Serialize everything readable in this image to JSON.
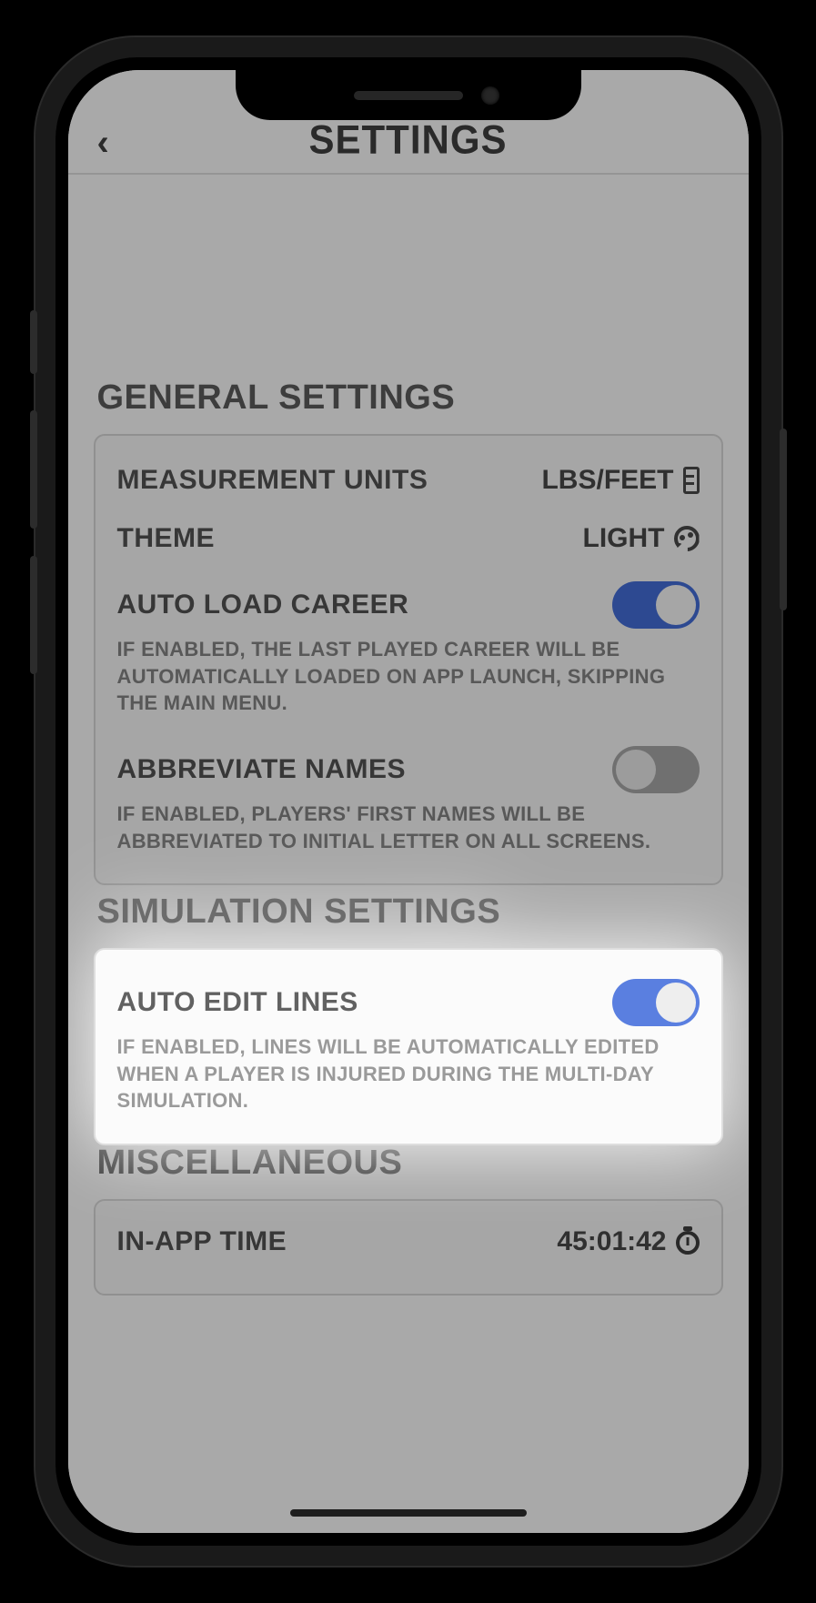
{
  "header": {
    "title": "SETTINGS"
  },
  "sections": {
    "general": {
      "title": "GENERAL SETTINGS",
      "measurement_units": {
        "label": "MEASUREMENT UNITS",
        "value": "LBS/FEET"
      },
      "theme": {
        "label": "THEME",
        "value": "LIGHT"
      },
      "auto_load_career": {
        "label": "AUTO LOAD CAREER",
        "enabled": true,
        "desc": "IF ENABLED, THE LAST PLAYED CAREER WILL BE AUTOMATICALLY LOADED ON APP LAUNCH, SKIPPING THE MAIN MENU."
      },
      "abbreviate_names": {
        "label": "ABBREVIATE NAMES",
        "enabled": false,
        "desc": "IF ENABLED, PLAYERS' FIRST NAMES WILL BE ABBREVIATED TO INITIAL LETTER ON ALL SCREENS."
      }
    },
    "simulation": {
      "title": "SIMULATION SETTINGS",
      "auto_edit_lines": {
        "label": "AUTO EDIT LINES",
        "enabled": true,
        "desc": "IF ENABLED, LINES WILL BE AUTOMATICALLY EDITED WHEN A PLAYER IS INJURED DURING THE MULTI-DAY SIMULATION."
      }
    },
    "misc": {
      "title": "MISCELLANEOUS",
      "in_app_time": {
        "label": "IN-APP TIME",
        "value": "45:01:42"
      }
    }
  },
  "colors": {
    "accent": "#3f66c9"
  }
}
